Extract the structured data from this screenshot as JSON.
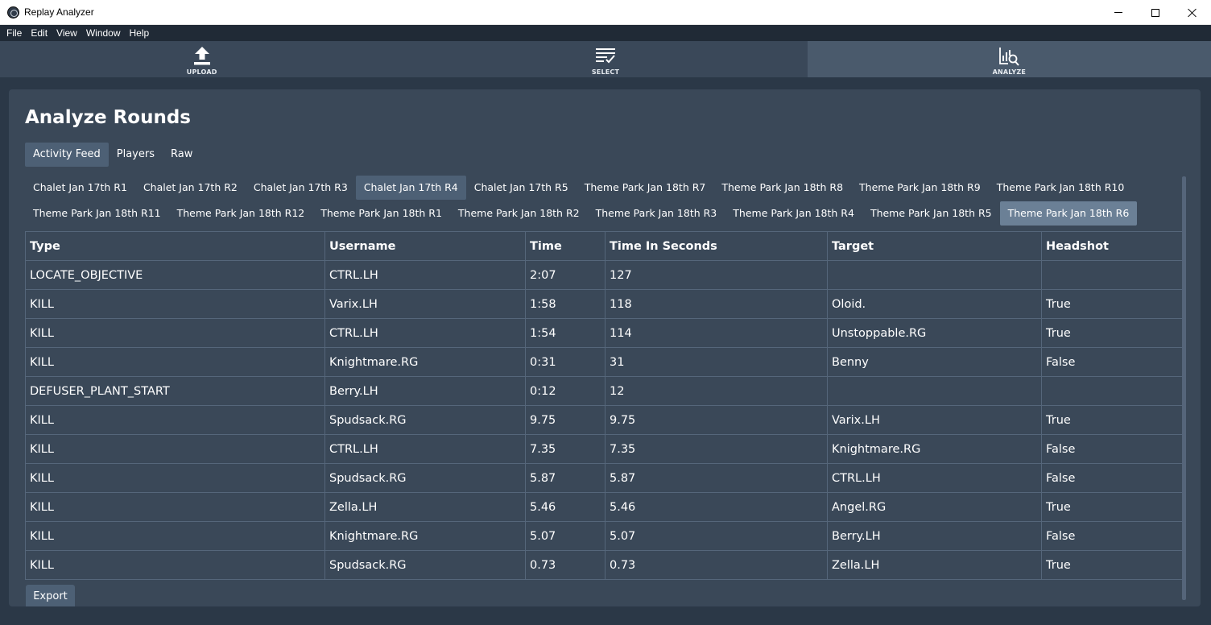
{
  "window": {
    "title": "Replay Analyzer"
  },
  "menu": [
    "File",
    "Edit",
    "View",
    "Window",
    "Help"
  ],
  "nav": [
    {
      "label": "UPLOAD",
      "icon": "upload-icon",
      "active": false
    },
    {
      "label": "SELECT",
      "icon": "checklist-icon",
      "active": false
    },
    {
      "label": "ANALYZE",
      "icon": "chart-search-icon",
      "active": true
    }
  ],
  "page": {
    "title": "Analyze Rounds",
    "subtabs": [
      "Activity Feed",
      "Players",
      "Raw"
    ],
    "active_subtab": 0
  },
  "rounds": {
    "row1": [
      "Chalet Jan 17th R1",
      "Chalet Jan 17th R2",
      "Chalet Jan 17th R3",
      "Chalet Jan 17th R4",
      "Chalet Jan 17th R5",
      "Theme Park Jan 18th R7",
      "Theme Park Jan 18th R8",
      "Theme Park Jan 18th R9",
      "Theme Park Jan 18th R10"
    ],
    "row2": [
      "Theme Park Jan 18th R11",
      "Theme Park Jan 18th R12",
      "Theme Park Jan 18th R1",
      "Theme Park Jan 18th R2",
      "Theme Park Jan 18th R3",
      "Theme Park Jan 18th R4",
      "Theme Park Jan 18th R5",
      "Theme Park Jan 18th R6"
    ],
    "highlighted": "Chalet Jan 17th R4",
    "selected": "Theme Park Jan 18th R6"
  },
  "table": {
    "columns": [
      "Type",
      "Username",
      "Time",
      "Time In Seconds",
      "Target",
      "Headshot"
    ],
    "rows": [
      [
        "LOCATE_OBJECTIVE",
        "CTRL.LH",
        "2:07",
        "127",
        "",
        ""
      ],
      [
        "KILL",
        "Varix.LH",
        "1:58",
        "118",
        "Oloid.",
        "True"
      ],
      [
        "KILL",
        "CTRL.LH",
        "1:54",
        "114",
        "Unstoppable.RG",
        "True"
      ],
      [
        "KILL",
        "Knightmare.RG",
        "0:31",
        "31",
        "Benny",
        "False"
      ],
      [
        "DEFUSER_PLANT_START",
        "Berry.LH",
        "0:12",
        "12",
        "",
        ""
      ],
      [
        "KILL",
        "Spudsack.RG",
        "9.75",
        "9.75",
        "Varix.LH",
        "True"
      ],
      [
        "KILL",
        "CTRL.LH",
        "7.35",
        "7.35",
        "Knightmare.RG",
        "False"
      ],
      [
        "KILL",
        "Spudsack.RG",
        "5.87",
        "5.87",
        "CTRL.LH",
        "False"
      ],
      [
        "KILL",
        "Zella.LH",
        "5.46",
        "5.46",
        "Angel.RG",
        "True"
      ],
      [
        "KILL",
        "Knightmare.RG",
        "5.07",
        "5.07",
        "Berry.LH",
        "False"
      ],
      [
        "KILL",
        "Spudsack.RG",
        "0.73",
        "0.73",
        "Zella.LH",
        "True"
      ]
    ]
  },
  "actions": {
    "export_label": "Export"
  },
  "colors": {
    "background": "#2b3847",
    "panel": "#3a4858",
    "tab_highlight": "#4d6075",
    "tab_selected": "#6b8096",
    "nav_active": "#4a5a6c"
  }
}
